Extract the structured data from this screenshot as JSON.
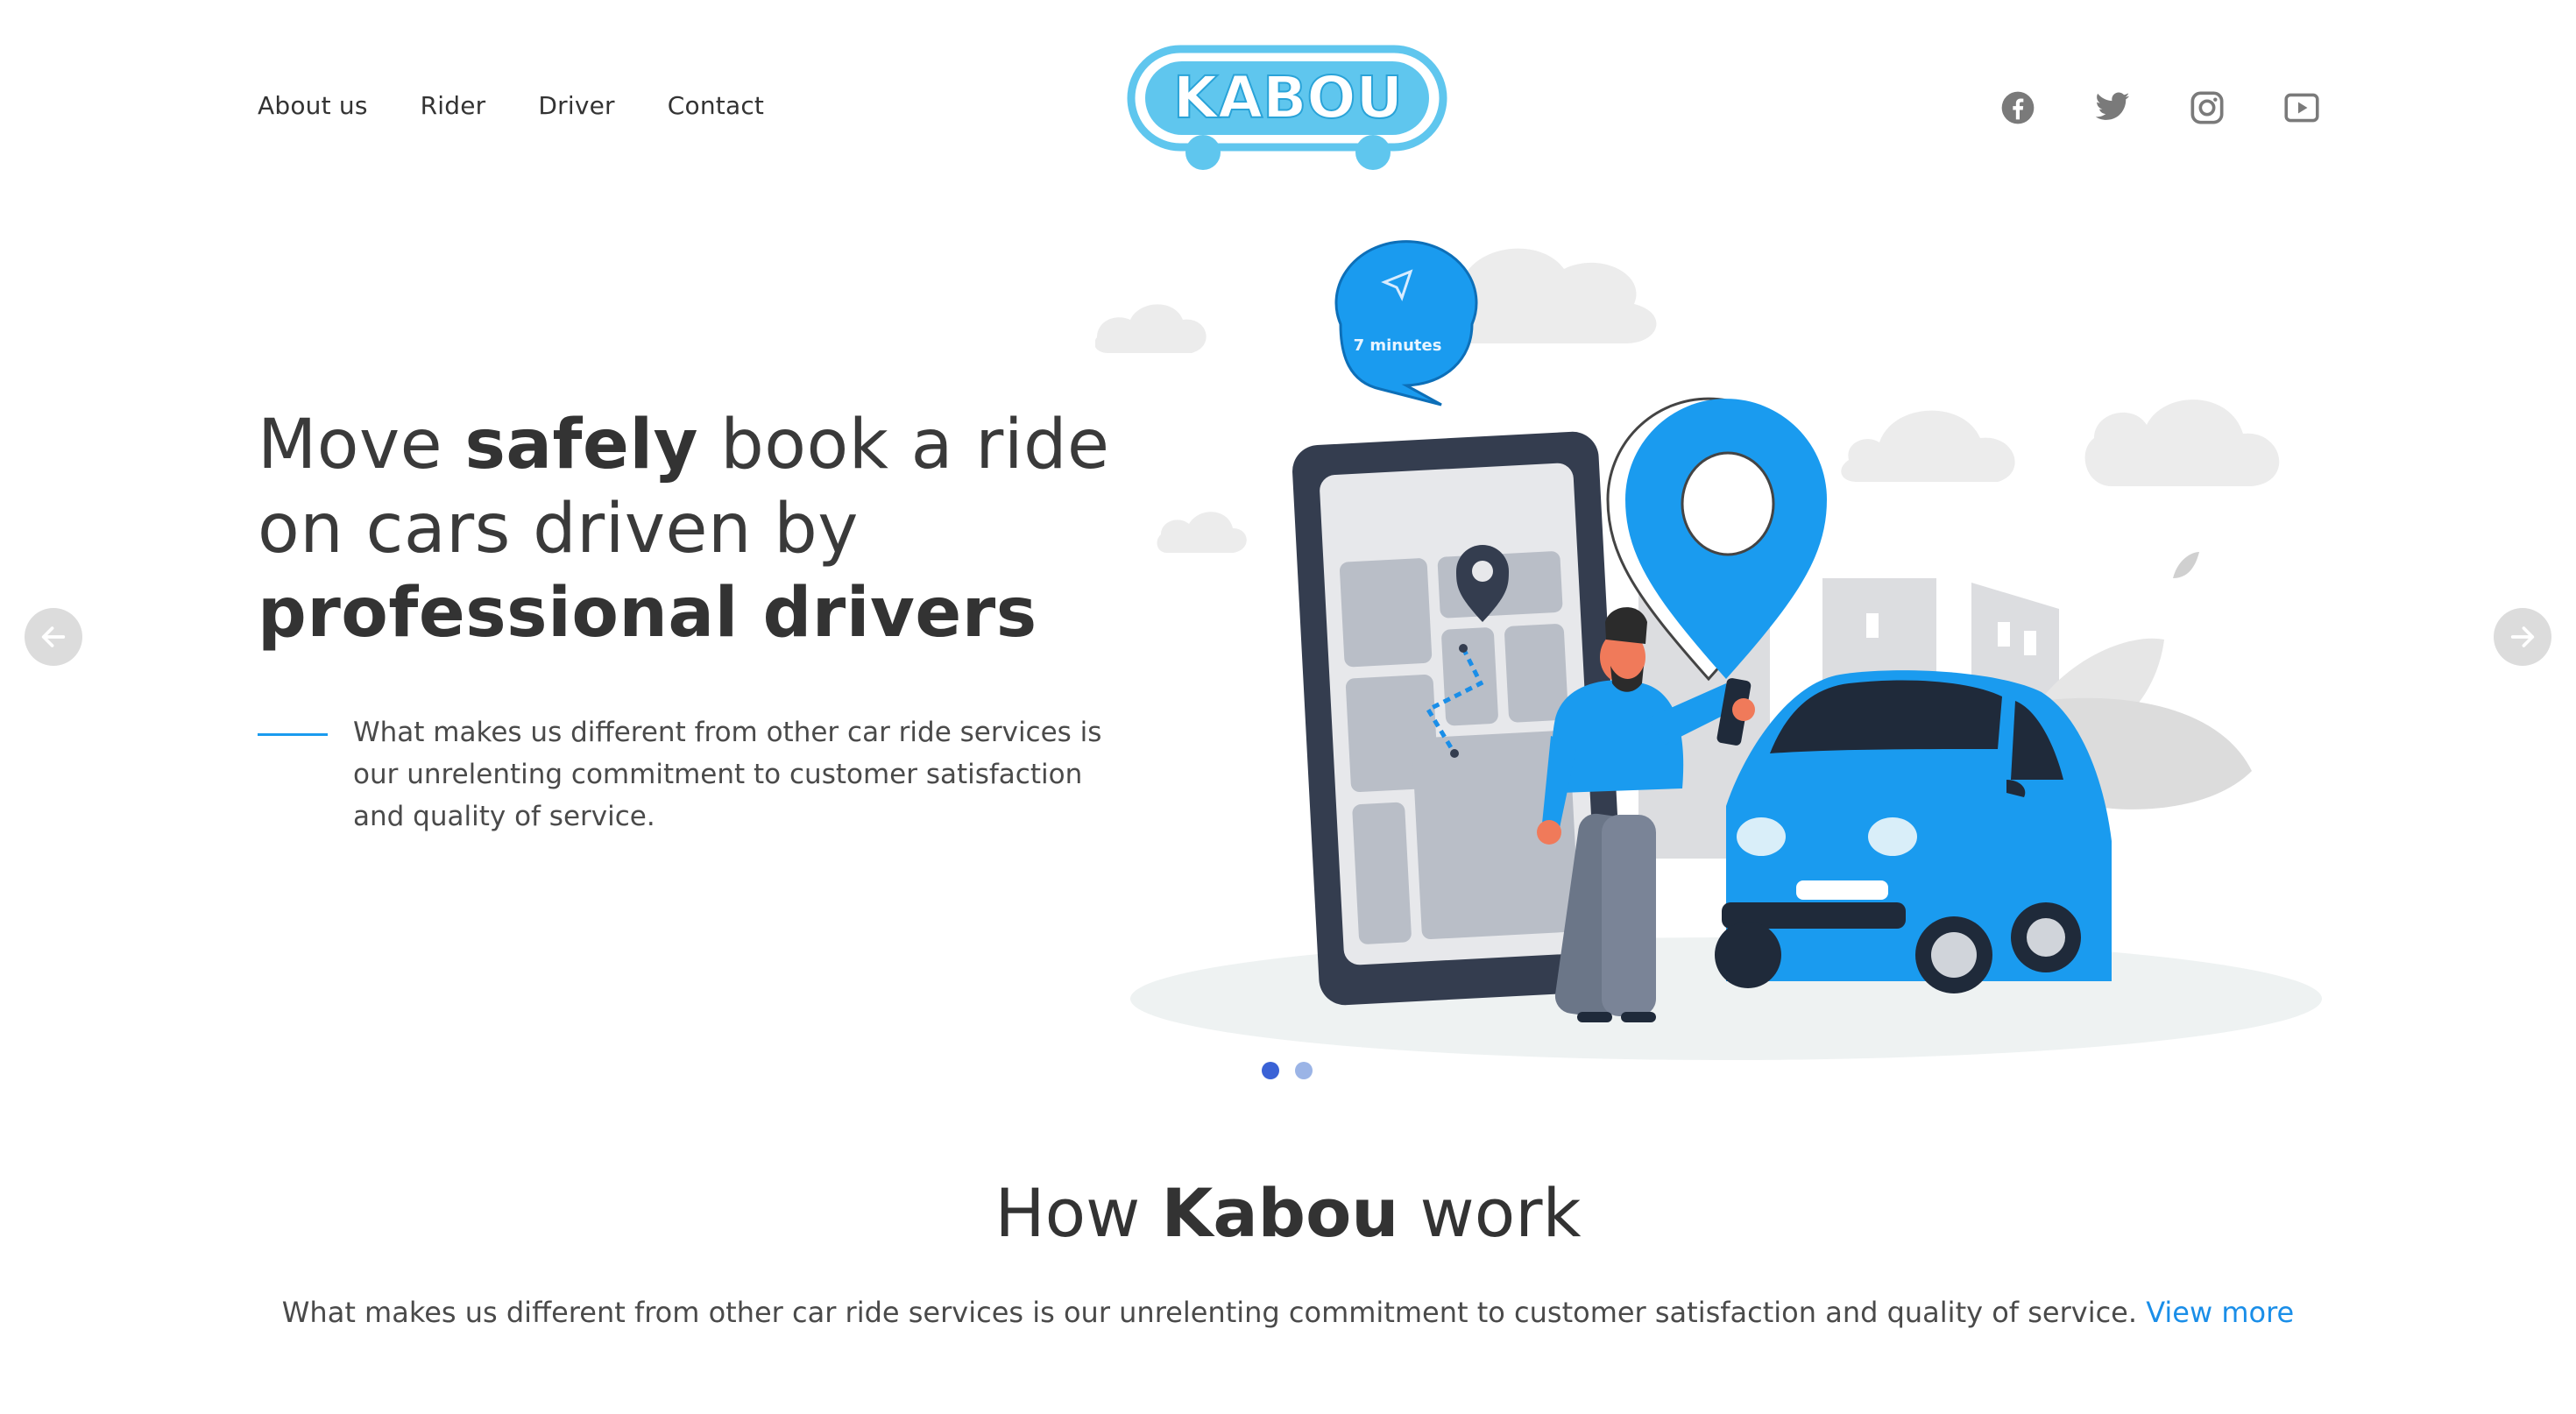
{
  "nav": {
    "items": [
      {
        "label": "About us"
      },
      {
        "label": "Rider"
      },
      {
        "label": "Driver"
      },
      {
        "label": "Contact"
      }
    ]
  },
  "logo": {
    "text": "KABOU"
  },
  "social": {
    "icons": [
      "facebook-icon",
      "twitter-icon",
      "instagram-icon",
      "youtube-icon"
    ]
  },
  "hero": {
    "title_part1": "Move ",
    "title_bold1": "safely",
    "title_part2": " book a ride on cars driven by ",
    "title_bold2": "professional drivers",
    "description": "What makes us different from other car ride services is our unrelenting commitment to customer satisfaction and quality of service.",
    "bubble_text": "7 minutes"
  },
  "carousel": {
    "slides": 2,
    "active_index": 0
  },
  "section": {
    "title_part1": "How ",
    "title_bold": "Kabou",
    "title_part2": " work",
    "description": "What makes us different from other car ride services is our unrelenting commitment to customer satisfaction and quality of service.",
    "link_text": "View more"
  },
  "colors": {
    "accent": "#1a9bef",
    "logo": "#5fc6ee",
    "text": "#3a3a3a"
  }
}
